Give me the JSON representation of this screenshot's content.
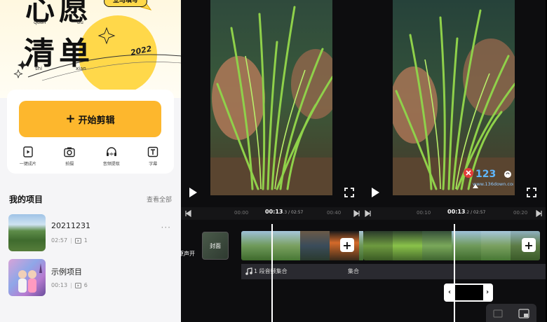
{
  "home": {
    "banner": {
      "pill_text": "立马填写",
      "title_line1": "心愿",
      "title_line2": "清单",
      "pinyin": [
        "quan",
        "bu",
        "shi",
        "xian"
      ],
      "year": "2022"
    },
    "start_button_label": "开始剪辑",
    "tools": [
      {
        "label": "一键成片",
        "icon": "one-click-video-icon"
      },
      {
        "label": "拍摄",
        "icon": "camera-icon"
      },
      {
        "label": "音频提取",
        "icon": "audio-extract-icon"
      },
      {
        "label": "字幕",
        "icon": "subtitle-icon"
      }
    ],
    "projects_title": "我的项目",
    "view_all": "查看全部",
    "projects": [
      {
        "name": "20211231",
        "duration": "02:57",
        "clips": "1"
      },
      {
        "name": "示例项目",
        "duration": "00:13",
        "clips": "6"
      }
    ]
  },
  "editorA": {
    "ticks": [
      "00:00",
      "00:40"
    ],
    "current_time": "00:13",
    "current_frac": ".3",
    "total_time": " / 02:57",
    "cover_label": "封面",
    "mute_label": "原声开",
    "audio_label": "1 段音频集合",
    "audio_label2": "集合"
  },
  "editorB": {
    "ticks": [
      "00:10",
      "00:20"
    ],
    "current_time": "00:13",
    "current_frac": ".2",
    "total_time": " / 02:57",
    "watermark": "www.136down.com"
  },
  "colors": {
    "accent": "#fdb72d",
    "banner_sun": "#ffd84a",
    "editor_bg": "#0d0d0f"
  }
}
